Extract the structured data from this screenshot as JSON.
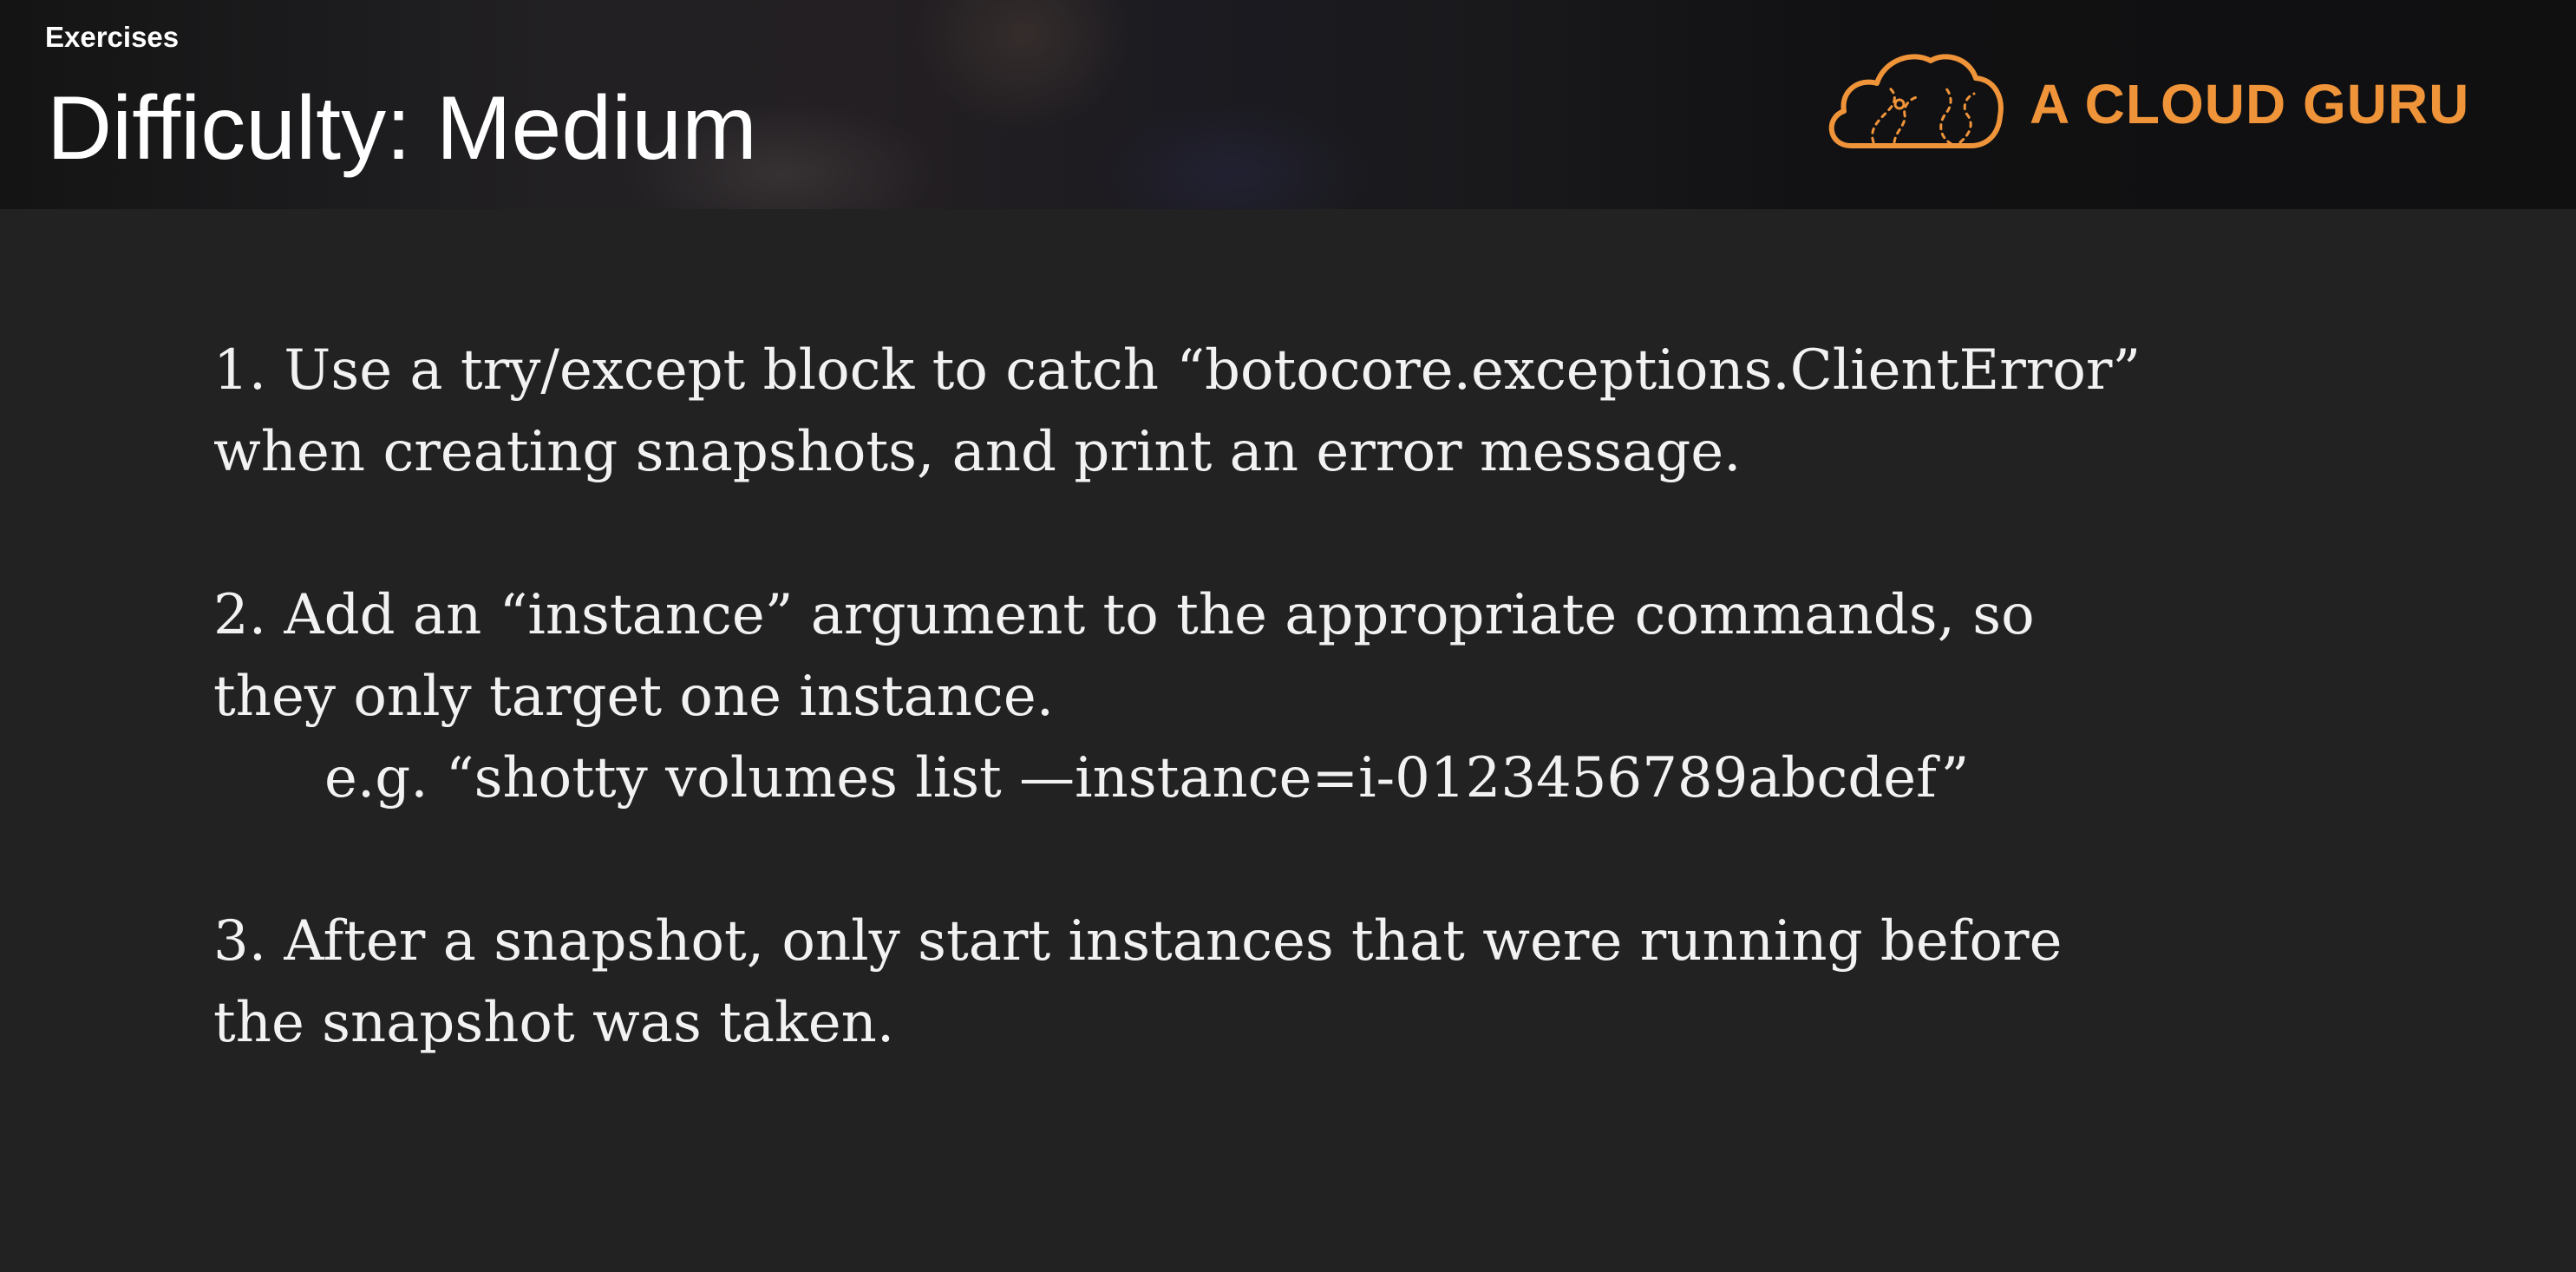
{
  "header": {
    "section_label": "Exercises",
    "title": "Difficulty: Medium",
    "brand": {
      "name": "A CLOUD GURU",
      "icon": "cloud-logo-icon",
      "color": "#f0943a"
    }
  },
  "exercises": [
    {
      "lines": [
        "1. Use a try/except block to catch “botocore.exceptions.ClientError”",
        "when creating snapshots, and print an error message."
      ]
    },
    {
      "lines": [
        "2. Add an “instance” argument to the appropriate commands, so",
        "they only target one instance."
      ],
      "example": "e.g. “shotty volumes list —instance=i-0123456789abcdef”"
    },
    {
      "lines": [
        "3. After a snapshot, only start instances that were running before",
        "the snapshot was taken."
      ]
    }
  ],
  "colors": {
    "background": "#222222",
    "text": "#f2f2f2",
    "accent": "#f0943a"
  }
}
